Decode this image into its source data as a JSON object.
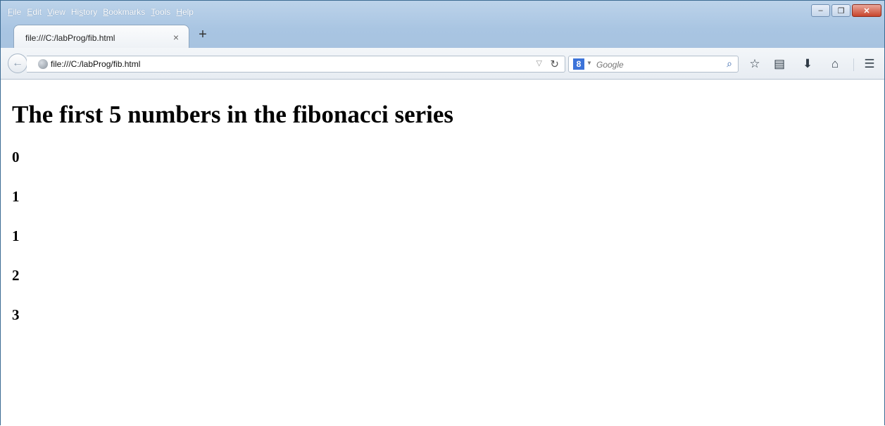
{
  "menu": [
    "File",
    "Edit",
    "View",
    "History",
    "Bookmarks",
    "Tools",
    "Help"
  ],
  "menu_accel": [
    "F",
    "E",
    "V",
    "s",
    "B",
    "T",
    "H"
  ],
  "tab": {
    "title": "file:///C:/labProg/fib.html",
    "close": "×",
    "new_tab": "+"
  },
  "window_controls": {
    "minimize": "–",
    "restore": "❐",
    "close": "✕"
  },
  "navbar": {
    "url": "file:///C:/labProg/fib.html",
    "search_placeholder": "Google",
    "search_engine_icon": "8"
  },
  "page": {
    "title": "The first 5 numbers in the fibonacci series",
    "numbers": [
      "0",
      "1",
      "1",
      "2",
      "3"
    ]
  }
}
